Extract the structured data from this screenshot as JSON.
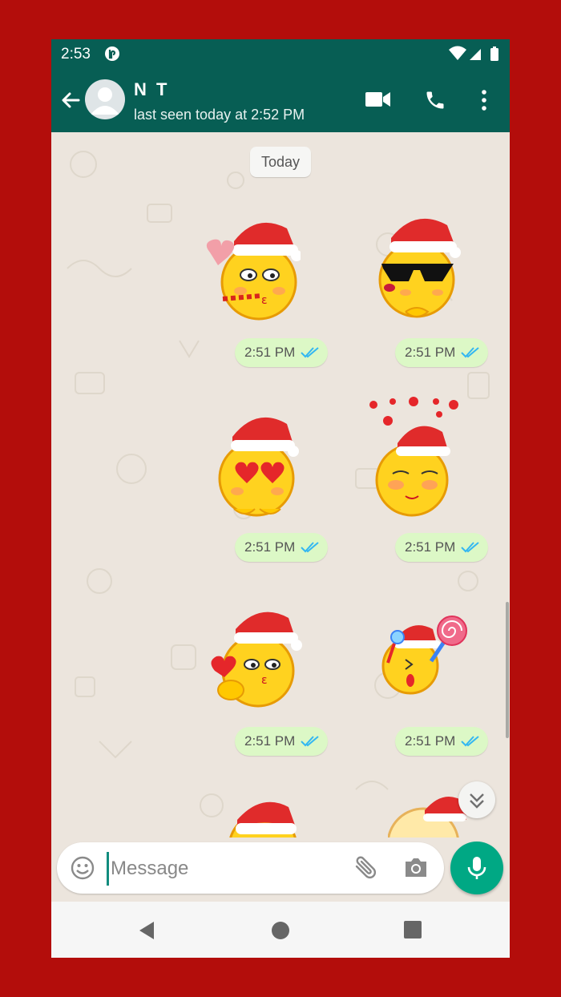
{
  "status_bar": {
    "time": "2:53"
  },
  "header": {
    "contact_name": "N T",
    "last_seen": "last seen today at 2:52 PM"
  },
  "chat": {
    "date_chip": "Today",
    "messages": [
      {
        "type": "sticker",
        "sticker": "kiss-heart-santa",
        "time": "2:51 PM",
        "status": "read"
      },
      {
        "type": "sticker",
        "sticker": "sunglasses-santa",
        "time": "2:51 PM",
        "status": "read"
      },
      {
        "type": "sticker",
        "sticker": "heart-eyes-santa",
        "time": "2:51 PM",
        "status": "read"
      },
      {
        "type": "sticker",
        "sticker": "blushing-hearts-santa",
        "time": "2:51 PM",
        "status": "read"
      },
      {
        "type": "sticker",
        "sticker": "blow-kiss-santa",
        "time": "2:51 PM",
        "status": "read"
      },
      {
        "type": "sticker",
        "sticker": "lollipop-santa",
        "time": "2:51 PM",
        "status": "read"
      }
    ]
  },
  "composer": {
    "placeholder": "Message"
  },
  "colors": {
    "header": "#075e54",
    "outgoing_bubble": "#dcf8c6",
    "read_tick": "#34b7f1",
    "mic_fab": "#00a884",
    "frame": "#b30d0b"
  },
  "icons": [
    "back-arrow-icon",
    "avatar-icon",
    "video-call-icon",
    "phone-icon",
    "more-vert-icon",
    "emoji-icon",
    "attach-icon",
    "camera-icon",
    "mic-icon",
    "scroll-down-icon"
  ]
}
